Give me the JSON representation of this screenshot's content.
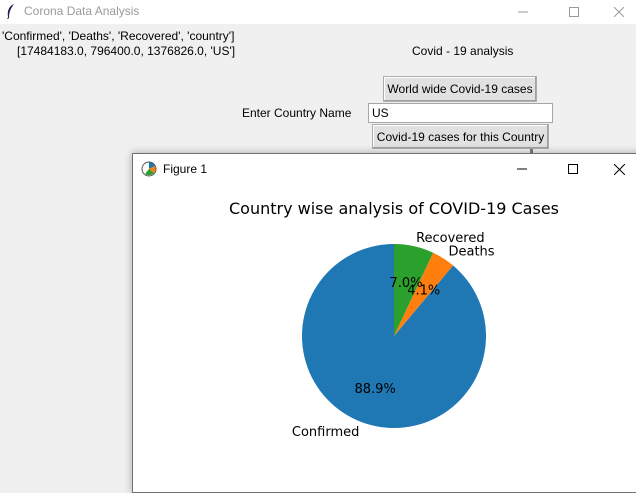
{
  "window": {
    "title": "Corona Data Analysis"
  },
  "info": {
    "columns_text": "'Confirmed', 'Deaths', 'Recovered', 'country']",
    "values_text": "[17484183.0, 796400.0, 1376826.0, 'US']"
  },
  "heading": "Covid - 19 analysis",
  "buttons": {
    "world_wide": "World wide Covid-19 cases",
    "country": "Covid-19 cases for this Country"
  },
  "country_input": {
    "label": "Enter Country Name",
    "value": "US"
  },
  "figure": {
    "title": "Figure 1"
  },
  "colors": {
    "confirmed": "#1f77b4",
    "deaths": "#ff7f0e",
    "recovered": "#2ca02c"
  },
  "chart_data": {
    "type": "pie",
    "title": "Country wise analysis of COVID-19 Cases",
    "labels": [
      "Confirmed",
      "Deaths",
      "Recovered"
    ],
    "values": [
      88.9,
      4.1,
      7.0
    ],
    "autopct_labels": [
      "88.9%",
      "4.1%",
      "7.0%"
    ],
    "start_angle": 90,
    "direction": "counterclockwise"
  }
}
